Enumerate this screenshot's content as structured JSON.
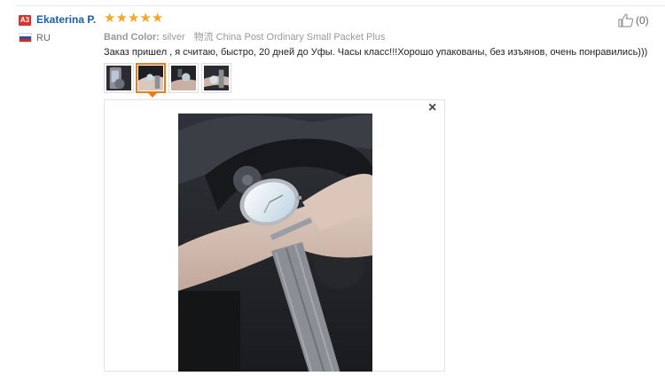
{
  "review": {
    "avatar_badge": "A3",
    "user_name": "Ekaterina P.",
    "country": "RU",
    "rating": 5,
    "stars": [
      "★",
      "★",
      "★",
      "★",
      "★"
    ],
    "attr_key": "Band Color:",
    "attr_value": "silver",
    "shipping": "物流 China Post Ordinary Small Packet Plus",
    "text": "Заказ пришел , я считаю, быстро, 20 дней до Уфы. Часы класс!!!Хорошо упакованы, без изъянов, очень понравились)))",
    "like_count": "(0)"
  },
  "thumbnails": {
    "count": 4,
    "selected_index": 1
  },
  "viewer": {
    "close_label": "×"
  },
  "colors": {
    "star": "#f5a623",
    "user_link": "#1a5fa8",
    "selected_border": "#f07c18",
    "badge": "#d9342b"
  },
  "icons": {
    "like": "thumb-up-icon",
    "close": "close-icon",
    "flag": "russia-flag-icon"
  }
}
